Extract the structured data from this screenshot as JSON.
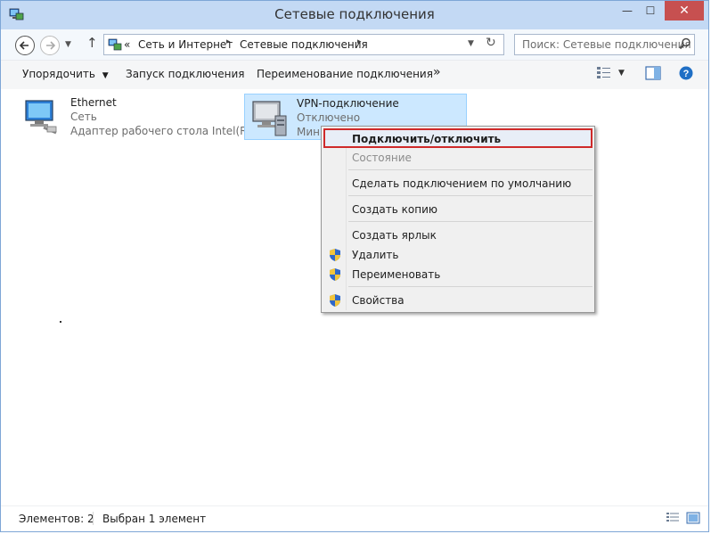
{
  "window": {
    "title": "Сетевые подключения"
  },
  "colors": {
    "titlebar": "#c3d9f4",
    "close_button": "#c75050",
    "selection": "#cce8ff",
    "highlight_border": "#cf2a2a"
  },
  "address": {
    "prefix": "«",
    "crumbs": [
      "Сеть и Интернет",
      "Сетевые подключения"
    ],
    "separator": "▸"
  },
  "search": {
    "placeholder": "Поиск: Сетевые подключения"
  },
  "toolbar": {
    "organize": "Упорядочить",
    "start_connection": "Запуск подключения",
    "rename_connection": "Переименование подключения",
    "more": "»"
  },
  "items": [
    {
      "name": "Ethernet",
      "line2": "Сеть",
      "line3": "Адаптер рабочего стола Intel(R) ...",
      "icon": "network-adapter-icon"
    },
    {
      "name": "VPN-подключение",
      "line2": "Отключено",
      "line3": "Мин",
      "icon": "vpn-connection-icon"
    }
  ],
  "context_menu": {
    "items": [
      {
        "label": "Подключить/отключить",
        "bold": true,
        "highlighted": true
      },
      {
        "label": "Состояние",
        "disabled": true
      },
      {
        "label": "Сделать подключением по умолчанию"
      },
      {
        "label": "Создать копию"
      },
      {
        "label": "Создать ярлык"
      },
      {
        "label": "Удалить",
        "icon": "shield-icon"
      },
      {
        "label": "Переименовать",
        "icon": "shield-icon"
      },
      {
        "label": "Свойства",
        "icon": "shield-icon"
      }
    ]
  },
  "status": {
    "count": "Элементов: 2",
    "selected": "Выбран 1 элемент"
  }
}
